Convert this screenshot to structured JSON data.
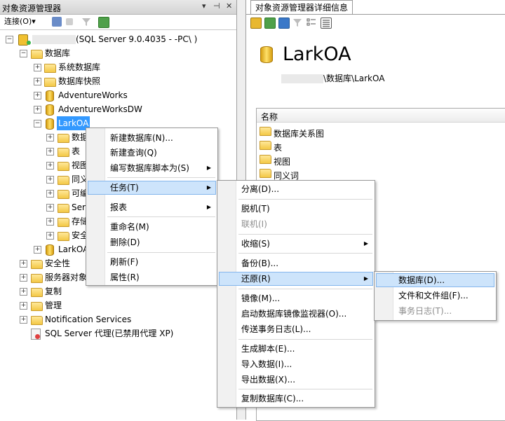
{
  "left_panel": {
    "title": "对象资源管理器",
    "pin_glyph": "▾ ⊣ ×",
    "toolbar": {
      "connect_label": "连接(O)▾"
    },
    "tree": {
      "server": {
        "label": "(SQL Server 9.0.4035 -           -PC\\          )"
      },
      "databases": "数据库",
      "system_dbs": "系统数据库",
      "db_snapshots": "数据库快照",
      "dbs": [
        "AdventureWorks",
        "AdventureWorksDW",
        "LarkOA"
      ],
      "larkoa_children": [
        "数据",
        "表",
        "视图",
        "同义",
        "可编",
        "Ser",
        "存储",
        "安全"
      ],
      "larkoa_second": "LarkOA",
      "security": "安全性",
      "server_objects": "服务器对象",
      "replication": "复制",
      "management": "管理",
      "notification": "Notification Services",
      "agent": "SQL Server 代理(已禁用代理 XP)"
    }
  },
  "right_panel": {
    "tab": "对象资源管理器详细信息",
    "db_name": "LarkOA",
    "path_suffix": "\\数据库\\LarkOA",
    "list_header": "名称",
    "list_items": [
      "数据库关系图",
      "表",
      "视图",
      "同义词"
    ]
  },
  "menu1": {
    "items": [
      "新建数据库(N)...",
      "新建查询(Q)",
      "编写数据库脚本为(S)",
      "任务(T)",
      "报表",
      "重命名(M)",
      "删除(D)",
      "刷新(F)",
      "属性(R)"
    ]
  },
  "menu2": {
    "items": [
      "分离(D)...",
      "脱机(T)",
      "联机(I)",
      "收缩(S)",
      "备份(B)...",
      "还原(R)",
      "镜像(M)...",
      "启动数据库镜像监视器(O)...",
      "传送事务日志(L)...",
      "生成脚本(E)...",
      "导入数据(I)...",
      "导出数据(X)...",
      "复制数据库(C)..."
    ]
  },
  "menu3": {
    "items": [
      "数据库(D)...",
      "文件和文件组(F)...",
      "事务日志(T)..."
    ]
  },
  "colors": {
    "selection": "#3399ff",
    "menu_highlight": "#cde4fb",
    "menu_highlight_border": "#84b6ec"
  }
}
